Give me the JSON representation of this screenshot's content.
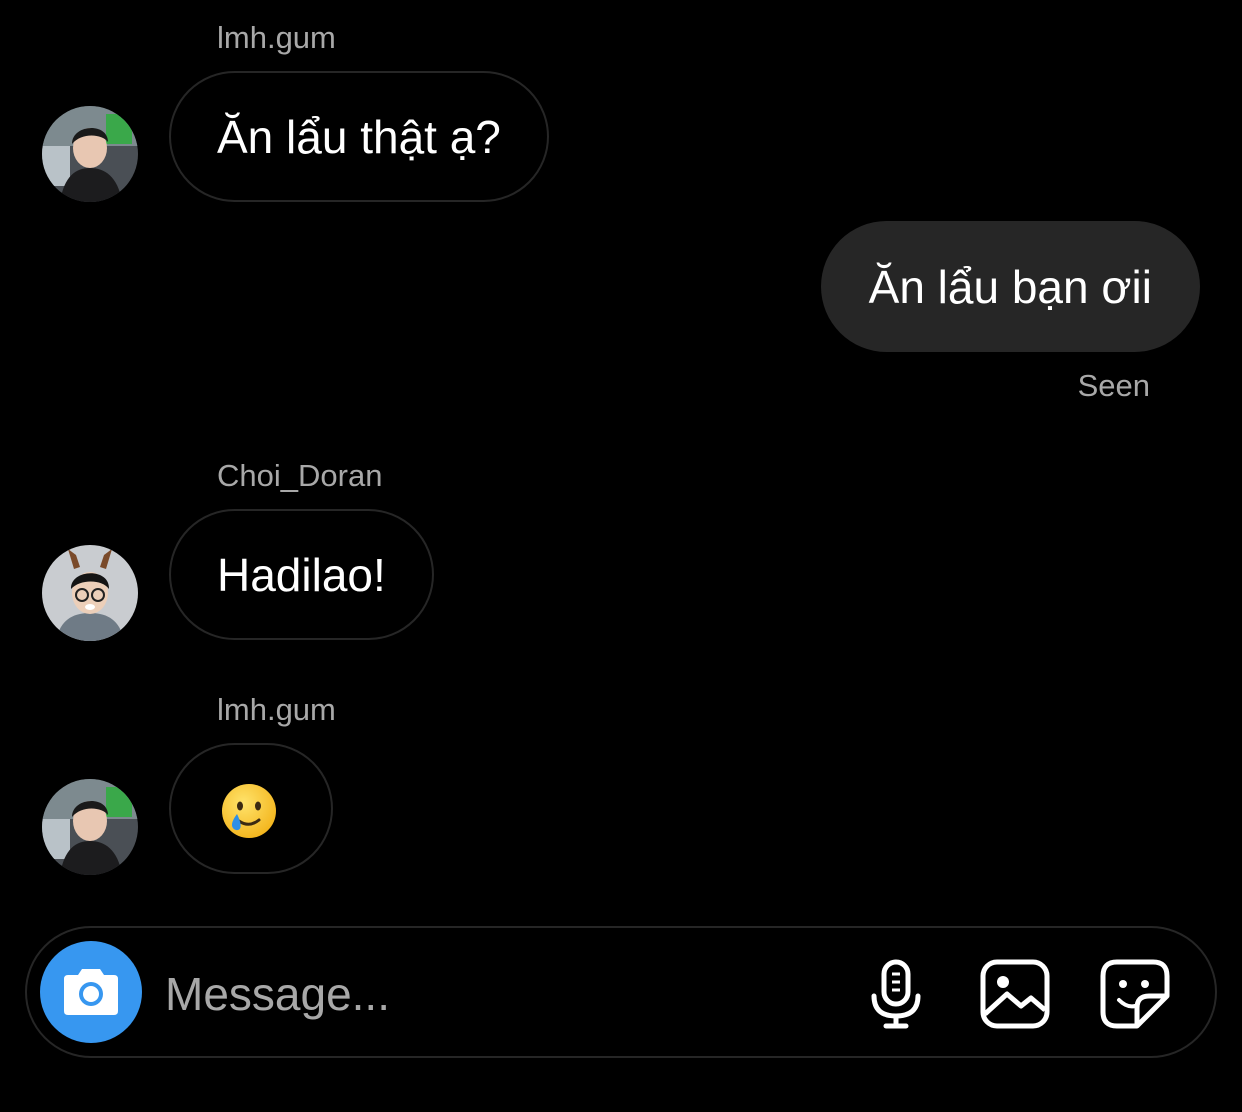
{
  "thread": {
    "messages": [
      {
        "sender": "lmh.gum",
        "text": "Ăn lẩu thật ạ?",
        "direction": "incoming"
      },
      {
        "text": "Ăn lẩu bạn ơii",
        "direction": "outgoing",
        "status": "Seen"
      },
      {
        "sender": "Choi_Doran",
        "text": "Hadilao!",
        "direction": "incoming"
      },
      {
        "sender": "lmh.gum",
        "emoji": "smiling-face-with-tear",
        "direction": "incoming"
      }
    ]
  },
  "composer": {
    "placeholder": "Message...",
    "icons": [
      "camera-icon",
      "microphone-icon",
      "gallery-icon",
      "sticker-icon"
    ]
  },
  "colors": {
    "background": "#000000",
    "outgoing_bubble": "#262626",
    "incoming_border": "#262626",
    "muted_text": "#a8a8a8",
    "accent": "#3797f0"
  }
}
